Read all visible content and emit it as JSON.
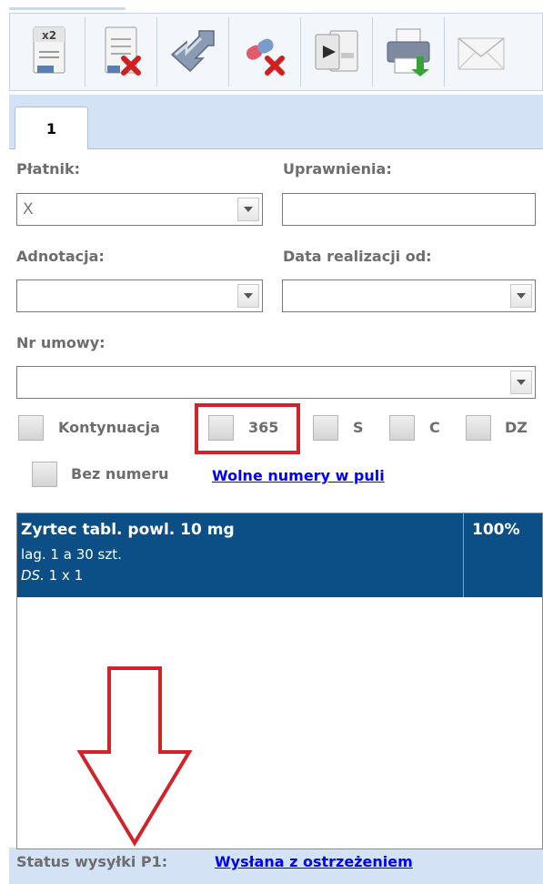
{
  "toolbar": {
    "buttons": [
      {
        "icon": "duplicate-prescription-x2-icon"
      },
      {
        "icon": "delete-prescription-icon"
      },
      {
        "icon": "move-arrows-icon"
      },
      {
        "icon": "delete-drug-icon"
      },
      {
        "icon": "export-document-icon"
      },
      {
        "icon": "print-icon"
      },
      {
        "icon": "send-envelope-icon"
      }
    ],
    "x2_label": "x2"
  },
  "tab": {
    "label": "1"
  },
  "form": {
    "platnik_label": "Płatnik:",
    "platnik_value": "X",
    "uprawnienia_label": "Uprawnienia:",
    "uprawnienia_value": "",
    "adnotacja_label": "Adnotacja:",
    "adnotacja_value": "",
    "data_label": "Data realizacji od:",
    "data_value": "",
    "umowa_label": "Nr umowy:",
    "umowa_value": ""
  },
  "checkboxes": {
    "kontynuacja": "Kontynuacja",
    "d365": "365",
    "s": "S",
    "c": "C",
    "dz": "DZ",
    "bez_numeru": "Bez numeru"
  },
  "links": {
    "wolne_numery": "Wolne numery w puli",
    "status_value": "Wysłana z ostrzeżeniem"
  },
  "drug": {
    "name": "Zyrtec tabl. powl. 10 mg",
    "pack": "lag. 1 a 30 szt.",
    "ds_prefix": "DS.",
    "ds_value": " 1 x 1",
    "percent": "100%"
  },
  "status": {
    "label": "Status wysyłki P1:"
  },
  "colors": {
    "selected_row": "#0b4f86",
    "highlight": "#d2232a",
    "link": "#0000ff",
    "panel_bg": "#d3e2f4"
  }
}
